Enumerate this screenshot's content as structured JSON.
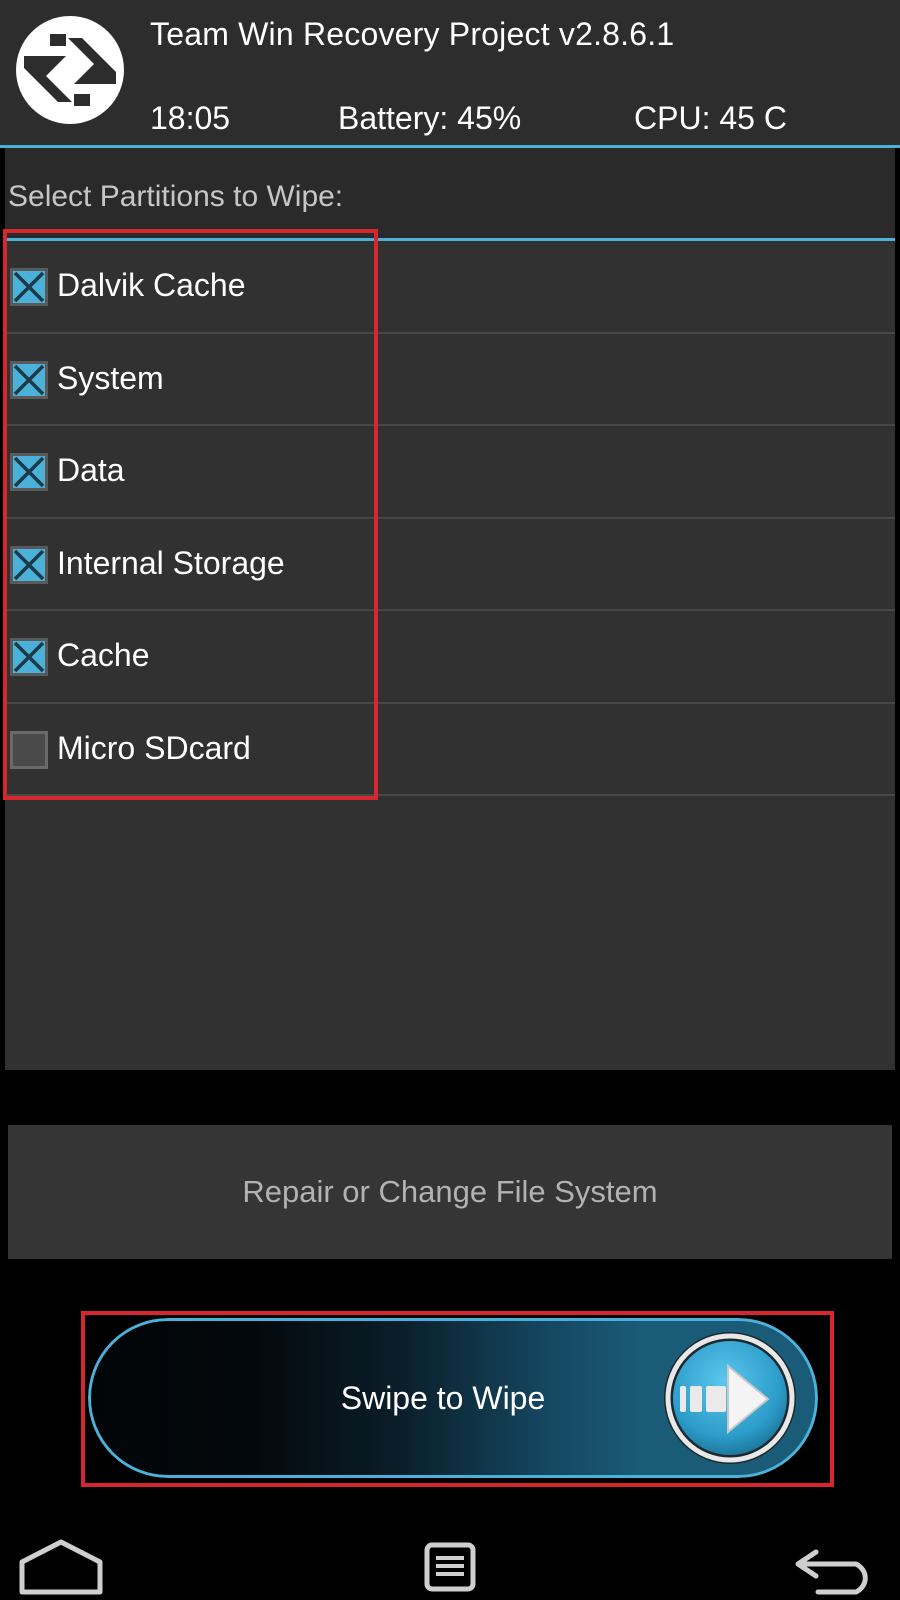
{
  "header": {
    "title": "Team Win Recovery Project  v2.8.6.1",
    "time": "18:05",
    "battery": "Battery: 45%",
    "cpu": "CPU: 45 C"
  },
  "wipe": {
    "prompt": "Select Partitions to Wipe:",
    "partitions": [
      {
        "label": "Dalvik Cache",
        "checked": true
      },
      {
        "label": "System",
        "checked": true
      },
      {
        "label": "Data",
        "checked": true
      },
      {
        "label": "Internal Storage",
        "checked": true
      },
      {
        "label": "Cache",
        "checked": true
      },
      {
        "label": "Micro SDcard",
        "checked": false
      }
    ],
    "repair_label": "Repair or Change File System",
    "swipe_label": "Swipe to Wipe"
  },
  "nav": {
    "home_icon": "home-icon",
    "menu_icon": "console-icon",
    "back_icon": "back-icon"
  },
  "colors": {
    "accent": "#4bb1d8",
    "highlight": "#d6262e",
    "checkbox_unchecked": "#5a5a5a"
  }
}
